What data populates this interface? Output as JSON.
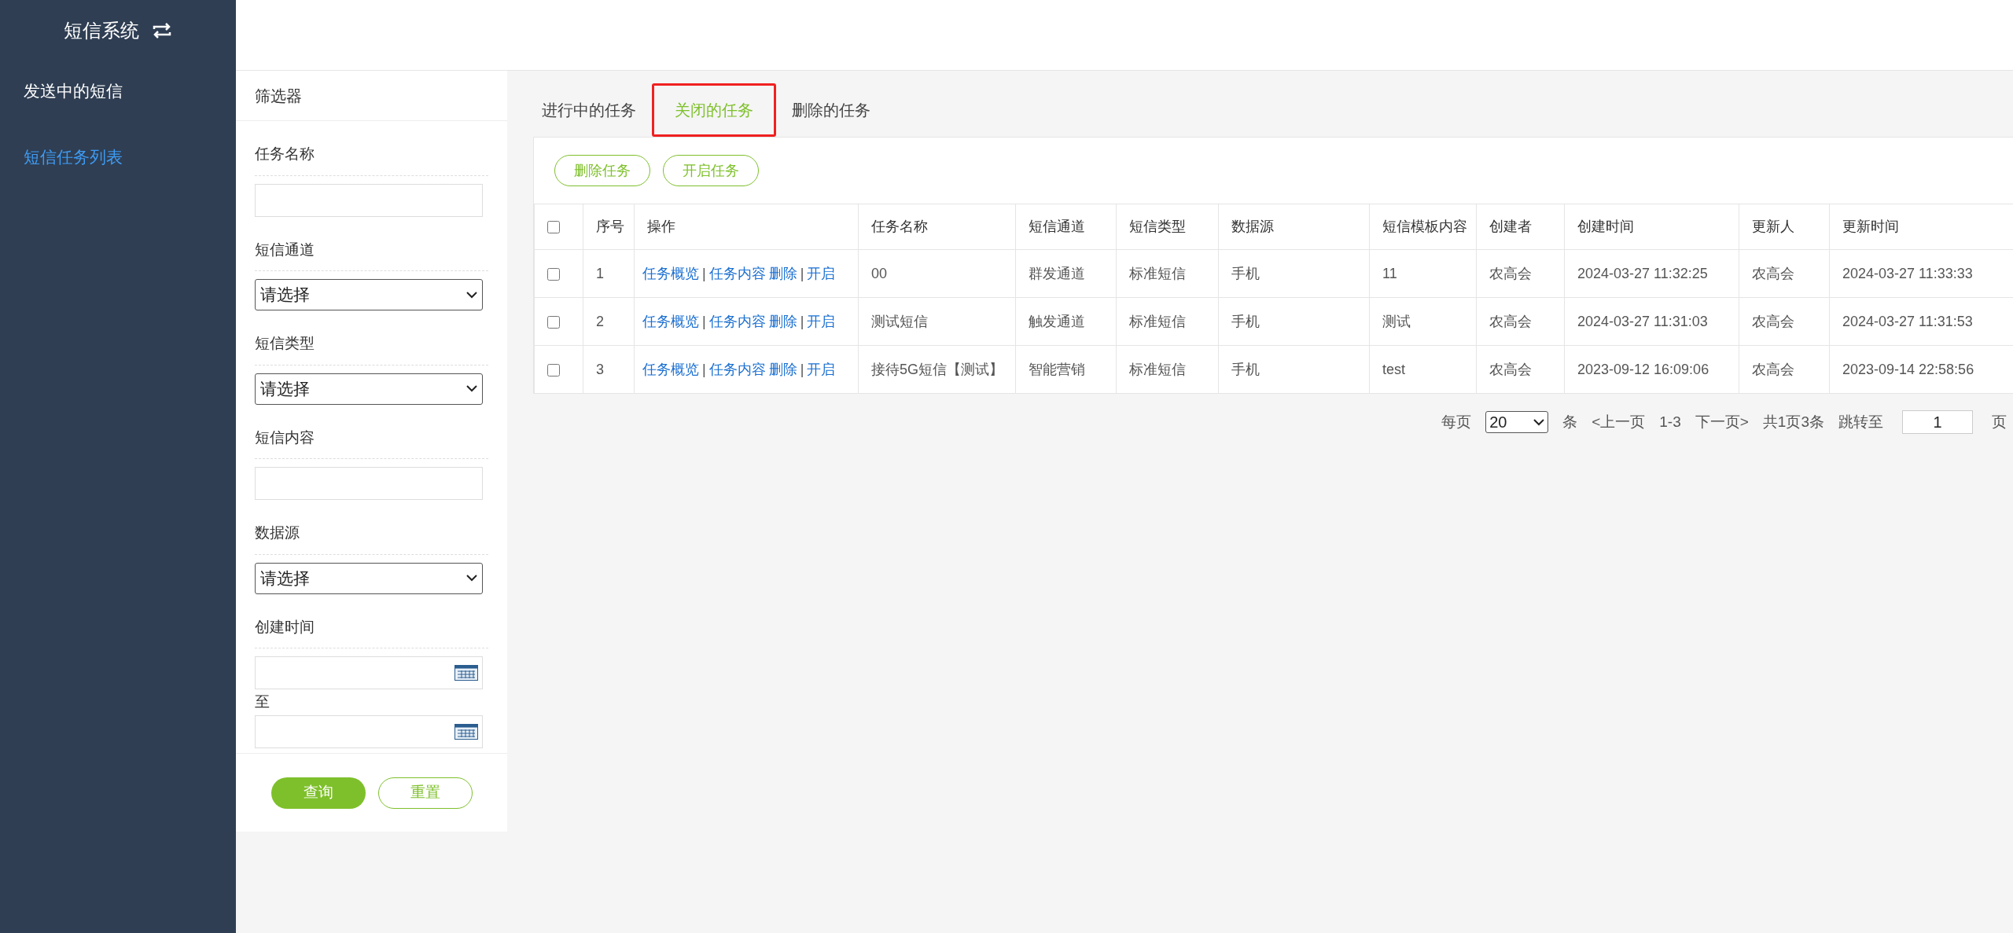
{
  "sidebar": {
    "title": "短信系统",
    "items": [
      {
        "label": "发送中的短信",
        "selected": false
      },
      {
        "label": "短信任务列表",
        "selected": true
      }
    ]
  },
  "filter": {
    "title": "筛选器",
    "fields": [
      {
        "kind": "text",
        "label": "任务名称"
      },
      {
        "kind": "select",
        "label": "短信通道",
        "value": "请选择"
      },
      {
        "kind": "select",
        "label": "短信类型",
        "value": "请选择"
      },
      {
        "kind": "text",
        "label": "短信内容"
      },
      {
        "kind": "select",
        "label": "数据源",
        "value": "请选择"
      },
      {
        "kind": "daterange",
        "label": "创建时间",
        "separator": "至"
      }
    ],
    "buttons": [
      {
        "label": "查询",
        "kind": "primary"
      },
      {
        "label": "重置",
        "kind": "outline"
      }
    ]
  },
  "tabs": [
    {
      "label": "进行中的任务",
      "selected": false
    },
    {
      "label": "关闭的任务",
      "selected": true
    },
    {
      "label": "删除的任务",
      "selected": false
    }
  ],
  "toolbar": [
    "删除任务",
    "开启任务"
  ],
  "table": {
    "columns": [
      "序号",
      "操作",
      "任务名称",
      "短信通道",
      "短信类型",
      "数据源",
      "短信模板内容",
      "创建者",
      "创建时间",
      "更新人",
      "更新时间"
    ],
    "header_checked": false,
    "rows": [
      {
        "checked": false,
        "cells": [
          "1",
          null,
          "00",
          "群发通道",
          "标准短信",
          "手机",
          "11",
          "农高会",
          "2024-03-27 11:32:25",
          "农高会",
          "2024-03-27 11:33:33"
        ],
        "actions": [
          {
            "kind": "link",
            "text": "任务概览"
          },
          {
            "kind": "separator",
            "text": "|"
          },
          {
            "kind": "link",
            "text": "任务内容"
          },
          {
            "kind": "link",
            "text": "删除"
          },
          {
            "kind": "separator",
            "text": "|"
          },
          {
            "kind": "link",
            "text": "开启"
          }
        ]
      },
      {
        "checked": false,
        "cells": [
          "2",
          null,
          "测试短信",
          "触发通道",
          "标准短信",
          "手机",
          "测试",
          "农高会",
          "2024-03-27 11:31:03",
          "农高会",
          "2024-03-27 11:31:53"
        ],
        "actions": [
          {
            "kind": "link",
            "text": "任务概览"
          },
          {
            "kind": "separator",
            "text": "|"
          },
          {
            "kind": "link",
            "text": "任务内容"
          },
          {
            "kind": "link",
            "text": "删除"
          },
          {
            "kind": "separator",
            "text": "|"
          },
          {
            "kind": "link",
            "text": "开启"
          }
        ]
      },
      {
        "checked": false,
        "cells": [
          "3",
          null,
          "接待5G短信【测试】",
          "智能营销",
          "标准短信",
          "手机",
          "test",
          "农高会",
          "2023-09-12 16:09:06",
          "农高会",
          "2023-09-14 22:58:56"
        ],
        "actions": [
          {
            "kind": "link",
            "text": "任务概览"
          },
          {
            "kind": "separator",
            "text": "|"
          },
          {
            "kind": "link",
            "text": "任务内容"
          },
          {
            "kind": "link",
            "text": "删除"
          },
          {
            "kind": "separator",
            "text": "|"
          },
          {
            "kind": "link",
            "text": "开启"
          }
        ]
      }
    ]
  },
  "pagination": {
    "per_page_label": "每页",
    "per_page": "20",
    "unit": "条",
    "prev": "<上一页",
    "range": "1-3",
    "next": "下一页>",
    "total": "共1页3条",
    "jump_label": "跳转至",
    "page": "1",
    "page_unit": "页"
  }
}
